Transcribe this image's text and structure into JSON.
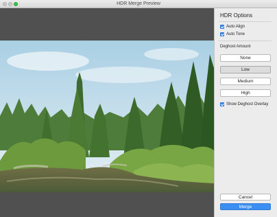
{
  "window": {
    "title": "HDR Merge Preview"
  },
  "sidebar": {
    "title": "HDR Options",
    "options": [
      {
        "label": "Auto Align",
        "checked": true
      },
      {
        "label": "Auto Tone",
        "checked": true
      }
    ],
    "deghost": {
      "label": "Deghost Amount",
      "levels": [
        "None",
        "Low",
        "Medium",
        "High"
      ],
      "selected": "Low"
    },
    "overlay": {
      "label": "Show Deghost Overlay",
      "checked": true
    }
  },
  "buttons": {
    "cancel": "Cancel",
    "merge": "Merge"
  },
  "colors": {
    "accent": "#3b8ef2",
    "checkbox": "#3a8cf0",
    "preview_bg": "#505050"
  }
}
